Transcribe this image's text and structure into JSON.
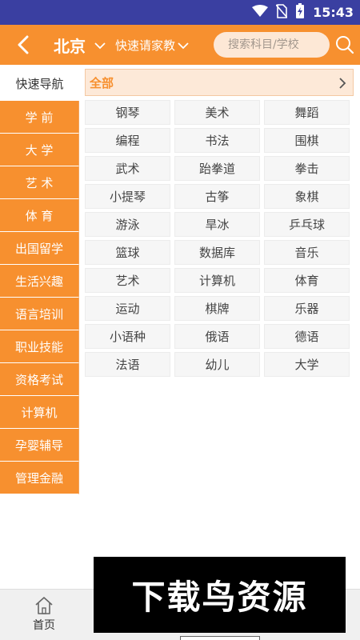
{
  "status_bar": {
    "time": "15:43",
    "icons": [
      "wifi-icon",
      "no-sim-icon",
      "battery-charging-icon"
    ]
  },
  "top_bar": {
    "back_icon": "back-arrow-icon",
    "city": "北京",
    "quick_tutor_label": "快速请家教",
    "search_placeholder": "搜索科目/学校",
    "search_icon": "search-icon"
  },
  "sidebar": {
    "items": [
      {
        "label": "快速导航",
        "active": true
      },
      {
        "label": "学 前"
      },
      {
        "label": "大 学"
      },
      {
        "label": "艺 术"
      },
      {
        "label": "体 育"
      },
      {
        "label": "出国留学"
      },
      {
        "label": "生活兴趣"
      },
      {
        "label": "语言培训"
      },
      {
        "label": "职业技能"
      },
      {
        "label": "资格考试"
      },
      {
        "label": "计算机"
      },
      {
        "label": "孕婴辅导"
      },
      {
        "label": "管理金融"
      }
    ]
  },
  "content": {
    "all_label": "全部",
    "subjects": [
      "钢琴",
      "美术",
      "舞蹈",
      "编程",
      "书法",
      "围棋",
      "武术",
      "跆拳道",
      "拳击",
      "小提琴",
      "古筝",
      "象棋",
      "游泳",
      "旱冰",
      "乒乓球",
      "篮球",
      "数据库",
      "音乐",
      "艺术",
      "计算机",
      "体育",
      "运动",
      "棋牌",
      "乐器",
      "小语种",
      "俄语",
      "德语",
      "法语",
      "幼儿",
      "大学"
    ]
  },
  "bottom_nav": {
    "home_label": "首页",
    "home_icon": "home-icon"
  },
  "watermark": {
    "text": "下载鸟资源"
  },
  "colors": {
    "accent": "#f7902f",
    "status_bar": "#3a3fa1",
    "search_bg": "#fde8d6"
  }
}
